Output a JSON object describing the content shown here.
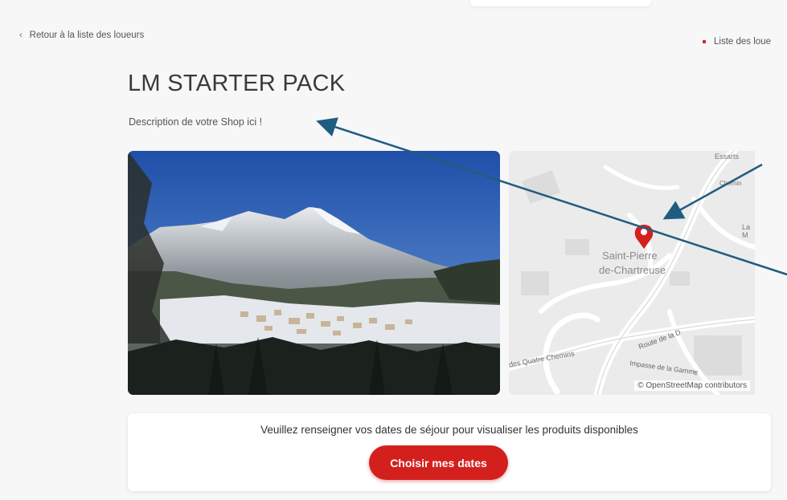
{
  "nav": {
    "back_label": "Retour à la liste des loueurs",
    "right_link": "Liste des loue"
  },
  "shop": {
    "title": "LM STARTER PACK",
    "description": "Description de votre Shop ici !"
  },
  "map": {
    "place_line1": "Saint-Pierre",
    "place_line2": "de-Chartreuse",
    "road1": "Route de la D",
    "road2": "e des Quatre Chemins",
    "road3": "Impasse de la Gamme",
    "corner1": "Essarts",
    "corner2": "Chemin",
    "corner3": "La M",
    "attribution": "© OpenStreetMap contributors"
  },
  "cta": {
    "prompt": "Veuillez renseigner vos dates de séjour pour visualiser les produits disponibles",
    "button_label": "Choisir mes dates"
  },
  "colors": {
    "accent": "#d4201d",
    "annotation_arrow": "#1f5d80"
  }
}
